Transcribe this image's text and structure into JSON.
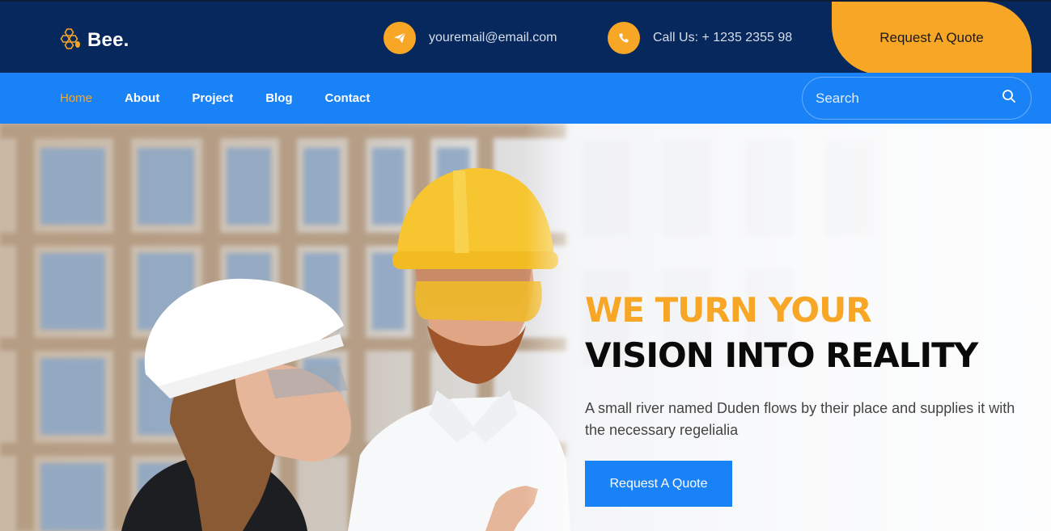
{
  "brand": {
    "name": "Bee.",
    "icon": "honeycomb-bee-icon"
  },
  "contacts": {
    "email": {
      "icon": "paper-plane-icon",
      "text": "youremail@email.com"
    },
    "phone": {
      "icon": "phone-icon",
      "text": "Call Us: + 1235 2355 98"
    }
  },
  "header": {
    "quote_button": "Request A Quote"
  },
  "nav": {
    "items": [
      {
        "label": "Home",
        "active": true
      },
      {
        "label": "About",
        "active": false
      },
      {
        "label": "Project",
        "active": false
      },
      {
        "label": "Blog",
        "active": false
      },
      {
        "label": "Contact",
        "active": false
      }
    ],
    "search": {
      "placeholder": "Search",
      "icon": "search-icon"
    }
  },
  "hero": {
    "headline_line1": "WE TURN YOUR",
    "headline_line2": "VISION INTO REALITY",
    "description": "A small river named Duden flows by their place and supplies it with the necessary regelialia",
    "cta": "Request A Quote",
    "image": "two-construction-workers-hard-hats-photo"
  },
  "colors": {
    "top_bar": "#06285c",
    "nav_bar": "#1a82f7",
    "accent": "#f8a626",
    "headline_dark": "#0a0a0a"
  }
}
